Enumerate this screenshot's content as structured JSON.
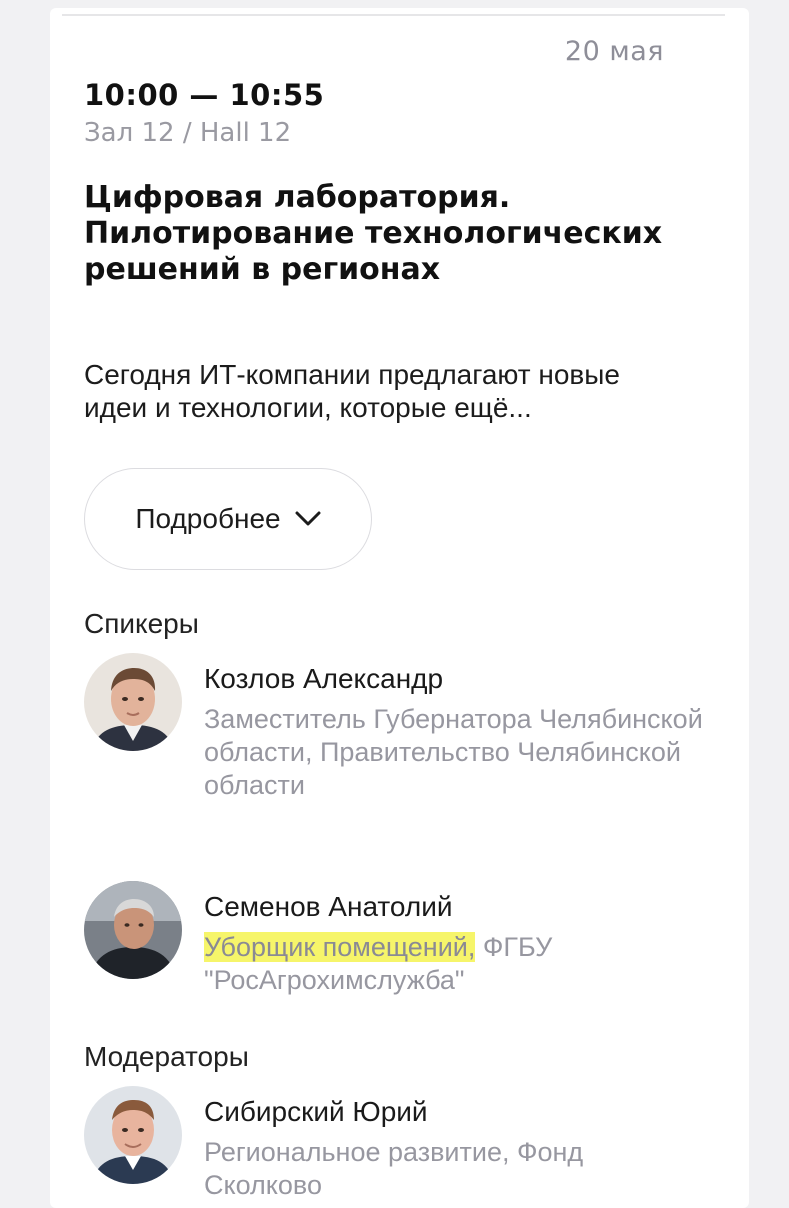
{
  "event": {
    "date": "20 мая",
    "time": "10:00 — 10:55",
    "hall": "Зал 12 / Hall 12",
    "title": "Цифровая лаборатория. Пилотирование технологических решений в регионах",
    "description": "Сегодня ИТ-компании предлагают новые идеи и технологии, которые ещё...",
    "more_button": "Подробнее",
    "more_icon": "chevron-down-icon"
  },
  "speakers": {
    "heading": "Спикеры",
    "items": [
      {
        "name": "Козлов Александр",
        "role": "Заместитель Губернатора Челябинской области, Правительство Челябинской области"
      },
      {
        "name": "Семенов Анатолий",
        "role_highlighted": "Уборщик помещений,",
        "role_rest": " ФГБУ \"РосАгрохимслужба\"",
        "highlight_color": "#f6f56a"
      }
    ]
  },
  "moderators": {
    "heading": "Модераторы",
    "items": [
      {
        "name": "Сибирский Юрий",
        "role": "Региональное развитие, Фонд Сколково"
      }
    ]
  }
}
